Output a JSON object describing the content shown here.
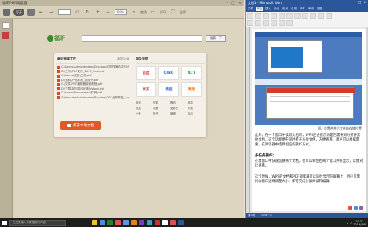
{
  "reader": {
    "title": "福昕PDF阅读器",
    "window_controls": [
      "–",
      "□",
      "×"
    ],
    "toolbar": {
      "open_label": "打开",
      "page_value": "",
      "zoom_value": "100%",
      "find_label": "查找",
      "print_label": "打印",
      "fullscreen_label": "全屏"
    },
    "search": {
      "logo_text": "福昕",
      "placeholder": "",
      "button_label": "搜索一下"
    },
    "recent": {
      "heading": "最近阅读文件",
      "more": "清除记录",
      "items": [
        "C:\\Users\\Administrator\\Desktop\\如何快速合并PDF.pdf",
        "D:\\工作\\PDF文件_2019_final.pdf",
        "C:\\Users\\报告\\文档.pdf",
        "D:\\资料\\产品手册_说明书.pdf",
        "C:\\文件\\PDF编辑器使用教程.pdf",
        "D:\\下载\\如何将PDF转为Word.pdf",
        "C:\\Users\\Documents\\样例.pdf",
        "C:\\Users\\Administrator\\Desktop\\PDF合并教程_1.pdf"
      ],
      "open_button": "打开本地文档"
    },
    "nav": {
      "heading": "网址导航",
      "tiles": [
        {
          "label": "百度",
          "color": "#d93025"
        },
        {
          "label": "QING",
          "color": "#2f6fc7"
        },
        {
          "label": "ACT",
          "color": "#2e9f4a"
        },
        {
          "label": "京东",
          "color": "#c7161d"
        },
        {
          "label": "携程",
          "color": "#3c7ad9"
        },
        {
          "label": "淘宝",
          "color": "#ff6a00"
        }
      ],
      "links": [
        "新浪",
        "搜狐",
        "腾讯",
        "网易",
        "凤凰",
        "优酷",
        "爱奇艺",
        "天猫",
        "头条",
        "知乎",
        "微博",
        "百科"
      ]
    },
    "sidebar_icons": [
      {
        "name": "page-thumbnail-icon",
        "color": "#ffffff"
      },
      {
        "name": "bookmark-icon",
        "color": "#cc3b3b"
      }
    ]
  },
  "word": {
    "title": "文档1 - Microsoft Word",
    "window_controls": [
      "–",
      "□",
      "×"
    ],
    "tabs": [
      "文件",
      "开始",
      "插入",
      "设计",
      "布局",
      "引用",
      "邮件",
      "审阅",
      "视图"
    ],
    "active_tab": "开始",
    "caption": "图3 设置合并后文件的存储位置",
    "paragraph1": "此外，在一个窗口中读取文档时，WPS还会提示你是否需要同时打开其他文档，这个功能便于同时打开多份文件，方便查看。用户可以根据需要，在阅读器中选择相应的操作方式。",
    "heading": "多任务操作：",
    "paragraph2": "在本窗口中快速切换两个文档，也可以将左右两个窗口并排显示，以便对比查看。",
    "paragraph3": "这个时候，WPS的文档和PDF阅读器可以同时显示在屏幕上，用户只需拖动窗口边缘调整大小，即可完成分屏阅读和编辑。",
    "status": {
      "page": "第3页",
      "words": "1024个字"
    }
  },
  "taskbar": {
    "search_placeholder": "在这里输入你要搜索的内容",
    "apps": [
      "#f1c232",
      "#4a90d9",
      "#2e7d32",
      "#d9534f",
      "#5b9bd5",
      "#e67e22",
      "#7b3fb5",
      "#3aa0c8",
      "#c0392b",
      "#ffffff",
      "#d9534f",
      "#2b579a"
    ],
    "time": "10:31",
    "date": "2019/4/8"
  }
}
